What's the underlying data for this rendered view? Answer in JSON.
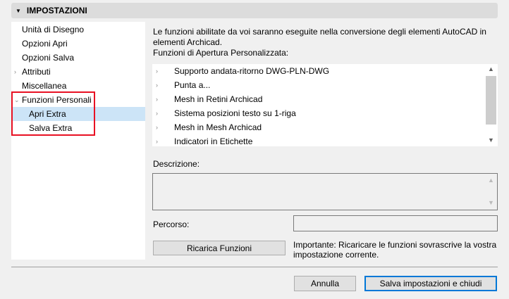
{
  "header": {
    "title": "IMPOSTAZIONI"
  },
  "tree": [
    {
      "label": "Unità di Disegno"
    },
    {
      "label": "Opzioni Apri"
    },
    {
      "label": "Opzioni Salva"
    },
    {
      "label": "Attributi"
    },
    {
      "label": "Miscellanea"
    },
    {
      "label": "Funzioni Personali"
    },
    {
      "label": "Apri Extra"
    },
    {
      "label": "Salva Extra"
    }
  ],
  "intro": {
    "line1": "Le funzioni abilitate da voi saranno eseguite nella conversione degli elementi AutoCAD in elementi Archicad.",
    "line2": "Funzioni di Apertura Personalizzata:"
  },
  "functions": [
    "Supporto andata-ritorno DWG-PLN-DWG",
    "Punta a...",
    "Mesh in Retini Archicad",
    "Sistema posizioni testo su 1-riga",
    "Mesh in Mesh Archicad",
    "Indicatori in Etichette"
  ],
  "description": {
    "label": "Descrizione:",
    "value": ""
  },
  "path": {
    "label": "Percorso:",
    "value": ""
  },
  "reload_label": "Ricarica Funzioni",
  "note": "Importante: Ricaricare le funzioni sovrascrive la vostra impostazione corrente.",
  "cancel_label": "Annulla",
  "save_label": "Salva impostazioni e chiudi"
}
